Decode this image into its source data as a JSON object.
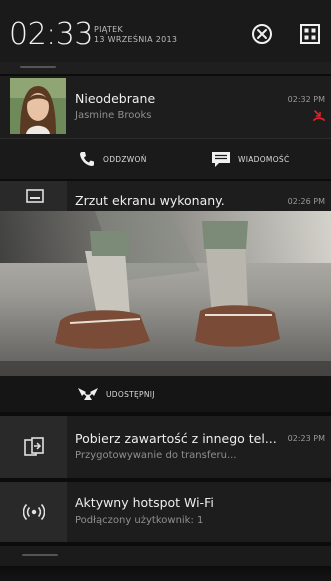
{
  "status": {
    "time": "02:33",
    "day": "PIĄTEK",
    "date": "13 WRZEŚNIA 2013",
    "dismiss_icon": "circle-x-icon",
    "settings_icon": "quick-settings-icon"
  },
  "notifications": {
    "missed_call": {
      "title": "Nieodebrane",
      "contact": "Jasmine Brooks",
      "time": "02:32 PM",
      "status_icon": "missed-call-icon",
      "actions": [
        {
          "label": "ODDZWOŃ",
          "icon": "phone-icon"
        },
        {
          "label": "WIADOMOŚĆ",
          "icon": "message-icon"
        }
      ]
    },
    "screenshot": {
      "title": "Zrzut ekranu wykonany.",
      "time": "02:26 PM",
      "icon": "screenshot-icon",
      "share_label": "UDOSTĘPNIJ",
      "share_icon": "share-icon"
    },
    "transfer": {
      "title": "Pobierz zawartość z innego tel...",
      "subtitle": "Przygotowywanie do transferu...",
      "time": "02:23 PM",
      "icon": "transfer-icon"
    },
    "hotspot": {
      "title": "Aktywny hotspot Wi-Fi",
      "subtitle": "Podłączony użytkownik: 1",
      "icon": "hotspot-icon"
    }
  },
  "colors": {
    "missed_call_red": "#d9262c",
    "background": "#0c0c0c",
    "card": "#1d1d1d",
    "icon_column": "#292929"
  }
}
